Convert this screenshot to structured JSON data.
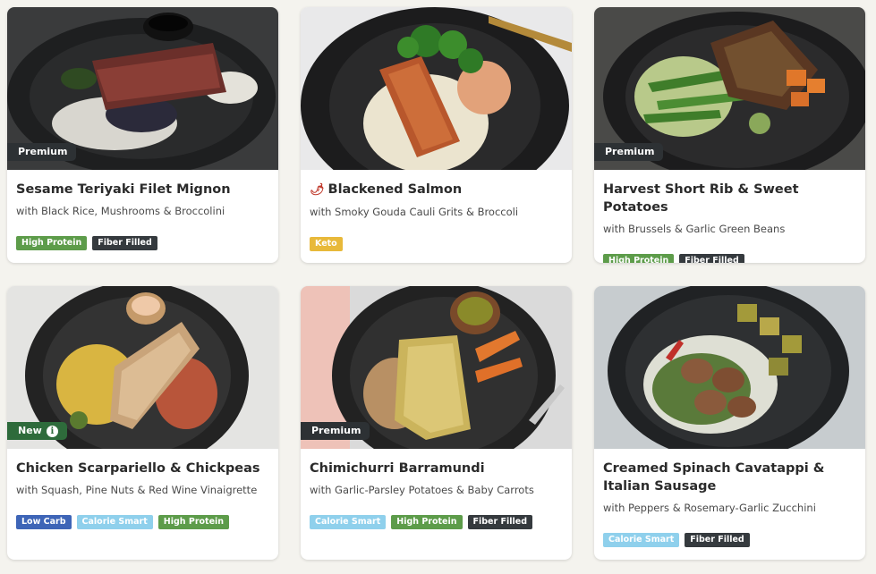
{
  "colors": {
    "high_protein": "#5d9c4a",
    "fiber_filled": "#353a3e",
    "keto": "#e8b93a",
    "low_carb": "#3e65b7",
    "calorie_smart": "#8fd0ec",
    "premium_flag": "#2d3134",
    "new_flag": "#2e6b3b"
  },
  "meals": [
    {
      "title": "Sesame Teriyaki Filet Mignon",
      "subtitle": "with Black Rice, Mushrooms & Broccolini",
      "flag": "Premium",
      "tags": [
        "High Protein",
        "Fiber Filled"
      ]
    },
    {
      "title": "Blackened Salmon",
      "subtitle": "with Smoky Gouda Cauli Grits & Broccoli",
      "icon": "chili-pepper-icon",
      "tags": [
        "Keto"
      ]
    },
    {
      "title": "Harvest Short Rib & Sweet Potatoes",
      "subtitle": "with Brussels & Garlic Green Beans",
      "flag": "Premium",
      "tags": [
        "High Protein",
        "Fiber Filled"
      ]
    },
    {
      "title": "Chicken Scarpariello & Chickpeas",
      "subtitle": "with Squash, Pine Nuts & Red Wine Vinaigrette",
      "flag": "New",
      "tags": [
        "Low Carb",
        "Calorie Smart",
        "High Protein"
      ]
    },
    {
      "title": "Chimichurri Barramundi",
      "subtitle": "with Garlic-Parsley Potatoes & Baby Carrots",
      "flag": "Premium",
      "tags": [
        "Calorie Smart",
        "High Protein",
        "Fiber Filled"
      ]
    },
    {
      "title": "Creamed Spinach Cavatappi & Italian Sausage",
      "subtitle": "with Peppers & Rosemary-Garlic Zucchini",
      "tags": [
        "Calorie Smart",
        "Fiber Filled"
      ]
    }
  ]
}
